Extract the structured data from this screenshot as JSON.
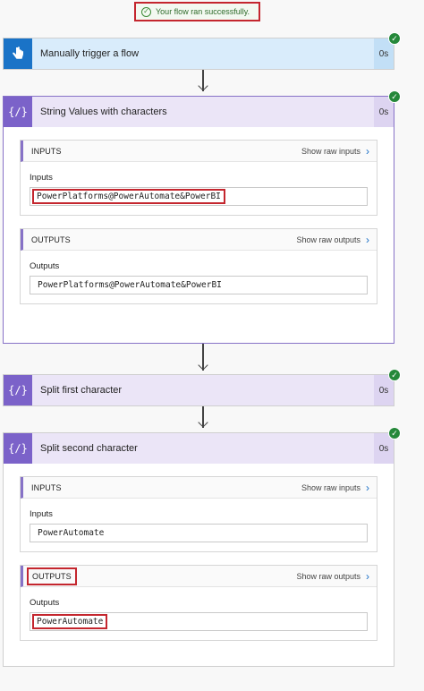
{
  "banner": {
    "text": "Your flow ran successfully."
  },
  "steps": {
    "trigger": {
      "title": "Manually trigger a flow",
      "duration": "0s",
      "icon": "hand-pointer-icon"
    },
    "string_values": {
      "title": "String Values with characters",
      "duration": "0s",
      "icon": "curly-braces-icon",
      "inputs": {
        "header": "INPUTS",
        "link": "Show raw inputs",
        "label": "Inputs",
        "value": "PowerPlatforms@PowerAutomate&PowerBI"
      },
      "outputs": {
        "header": "OUTPUTS",
        "link": "Show raw outputs",
        "label": "Outputs",
        "value": "PowerPlatforms@PowerAutomate&PowerBI"
      }
    },
    "split_first": {
      "title": "Split first character",
      "duration": "0s",
      "icon": "curly-braces-icon"
    },
    "split_second": {
      "title": "Split second character",
      "duration": "0s",
      "icon": "curly-braces-icon",
      "inputs": {
        "header": "INPUTS",
        "link": "Show raw inputs",
        "label": "Inputs",
        "value": "PowerAutomate"
      },
      "outputs": {
        "header": "OUTPUTS",
        "link": "Show raw outputs",
        "label": "Outputs",
        "value": "PowerAutomate"
      }
    }
  },
  "colors": {
    "success": "#25883a",
    "highlight": "#c4262e",
    "trigger": "#1a73c7",
    "compose": "#7b62c9"
  }
}
